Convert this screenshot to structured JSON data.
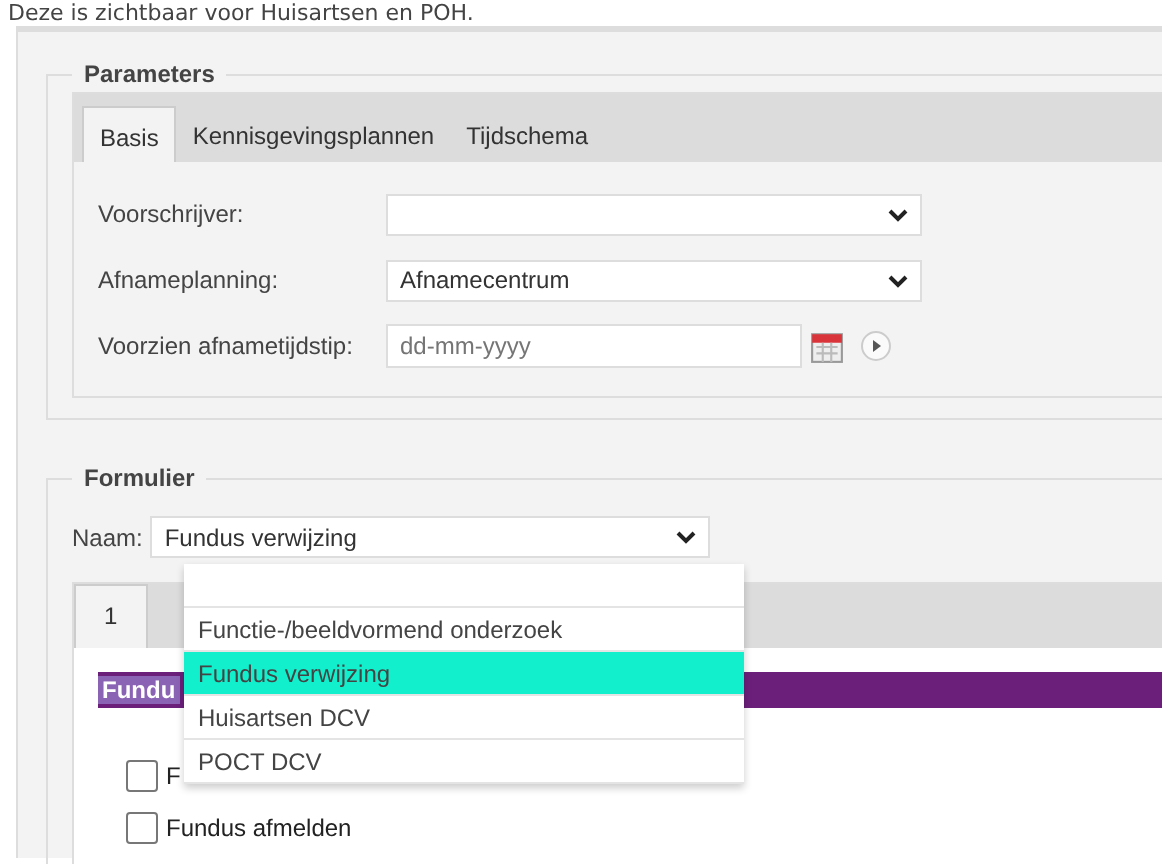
{
  "caption": "Deze is zichtbaar voor Huisartsen en POH.",
  "parameters": {
    "legend": "Parameters",
    "tabs": [
      {
        "label": "Basis",
        "selected": true
      },
      {
        "label": "Kennisgevingsplannen",
        "selected": false
      },
      {
        "label": "Tijdschema",
        "selected": false
      }
    ],
    "fields": [
      {
        "kind": "select",
        "label": "Voorschrijver:"
      },
      {
        "kind": "select",
        "label": "Afnameplanning:",
        "value": "Afnamecentrum"
      },
      {
        "kind": "date",
        "label": "Voorzien afnametijdstip:",
        "placeholder": "dd-mm-yyyy"
      }
    ]
  },
  "form": {
    "legend": "Formulier",
    "name_label": "Naam:",
    "name_value": "Fundus verwijzing",
    "tabs": [
      {
        "label": "1",
        "selected": true
      }
    ],
    "section_title": "Fundu",
    "checkboxes": [
      {
        "label": "F",
        "checked": false
      },
      {
        "label": "Fundus afmelden",
        "checked": false
      }
    ],
    "dropdown": [
      {
        "selected": false
      },
      {
        "label": "Functie-/beeldvormend onderzoek",
        "selected": false
      },
      {
        "label": "Fundus verwijzing",
        "selected": true
      },
      {
        "label": "Huisartsen DCV",
        "selected": false
      },
      {
        "label": "POCT DCV",
        "selected": false
      }
    ]
  }
}
